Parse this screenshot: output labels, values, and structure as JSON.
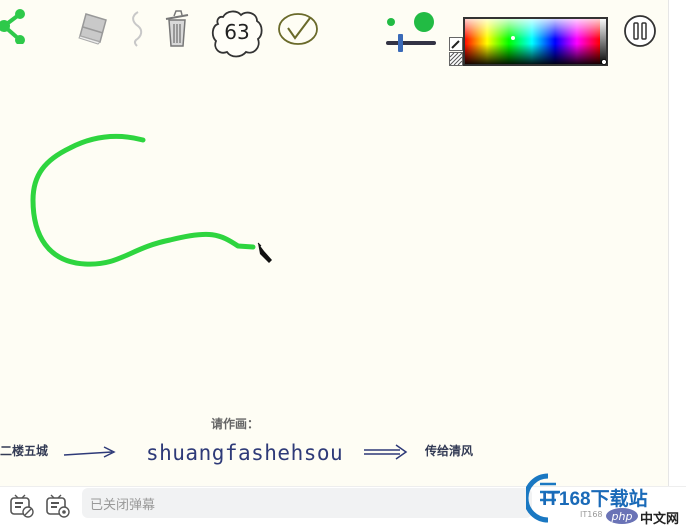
{
  "toolbar": {
    "counter": "63",
    "share_icon": "share-icon",
    "eraser_icon": "eraser-icon",
    "undo_icon": "undo-icon",
    "trash_icon": "trash-icon",
    "confirm_icon": "checkmark-icon",
    "pause_icon": "pause-icon"
  },
  "brush": {
    "small_color": "#22bb44",
    "large_color": "#22bb44",
    "size_level": 0.3
  },
  "stroke_color": "#2ed53f",
  "prompt": {
    "label": "请作画：",
    "left_name": "二楼五城",
    "word": "shuangfashehsou",
    "right_name": "传给清风"
  },
  "bottom": {
    "danmaku_placeholder": "已关闭弹幕"
  },
  "watermark": {
    "brand_text": "IT168下载站",
    "sub_text": "IT168",
    "php_text": "php",
    "cn_text": "中文网"
  }
}
